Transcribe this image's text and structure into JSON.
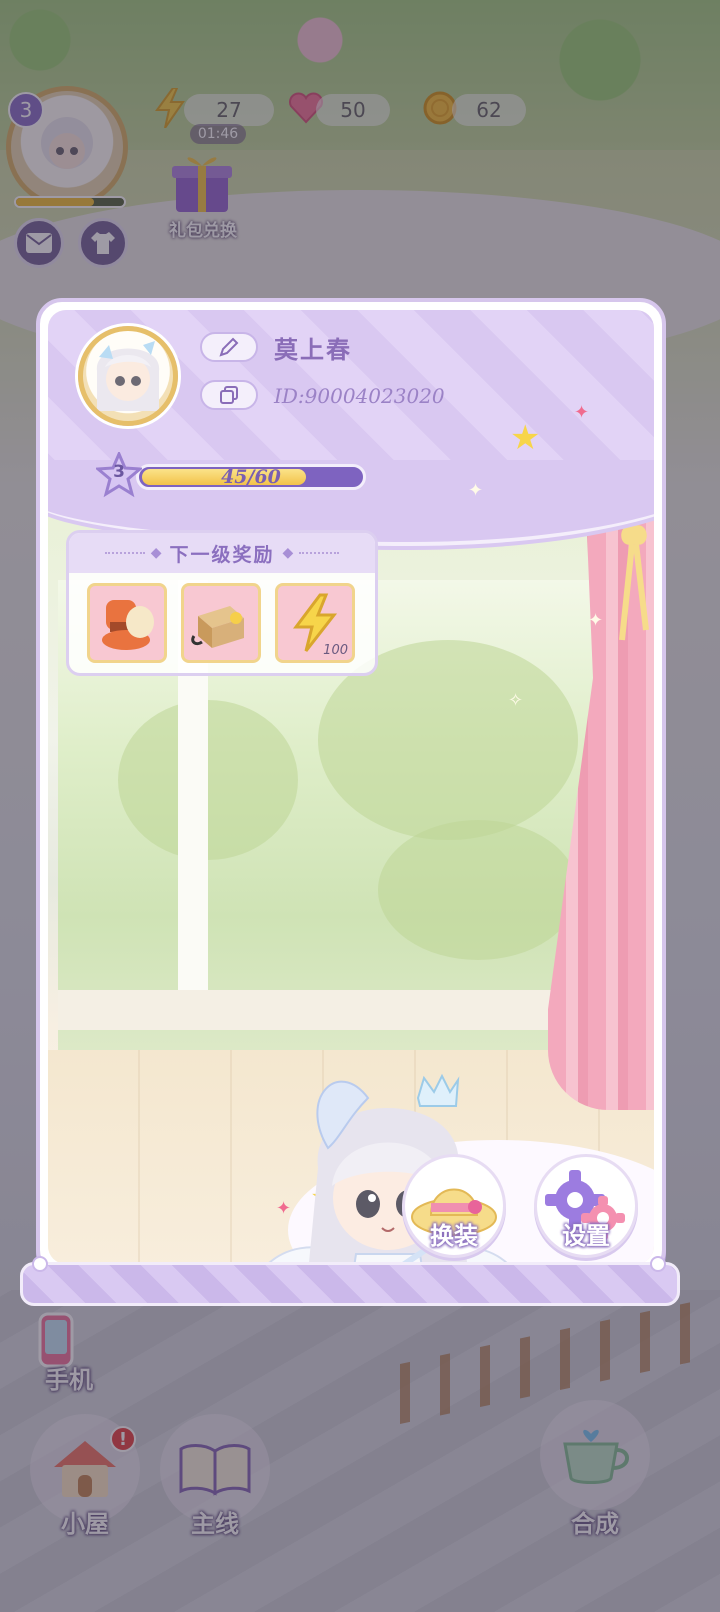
{
  "hud": {
    "player_level": "3",
    "energy": "27",
    "energy_timer": "01:46",
    "gems": "50",
    "coins": "62",
    "gift_label": "礼包兑换"
  },
  "profile": {
    "name": "莫上春",
    "id_text": "ID:90004023020",
    "level": "3",
    "exp_text": "45/60",
    "exp_fraction": 0.75
  },
  "next_reward": {
    "title": "下一级奖励",
    "items": [
      {
        "icon": "furniture-set-icon",
        "count": ""
      },
      {
        "icon": "treasure-box-icon",
        "count": ""
      },
      {
        "icon": "energy-bolt-icon",
        "count": "100"
      }
    ]
  },
  "actions": {
    "dress_up_label": "换装",
    "settings_label": "设置"
  },
  "bottom_nav": {
    "phone_label": "手机",
    "house_label": "小屋",
    "house_badge": "!",
    "story_label": "主线",
    "merge_label": "合成"
  },
  "colors": {
    "panel_purple": "#d9c8f1",
    "accent_purple": "#7e63c0",
    "exp_gold": "#f2c24a",
    "curtain_pink": "#f3a9bd"
  }
}
